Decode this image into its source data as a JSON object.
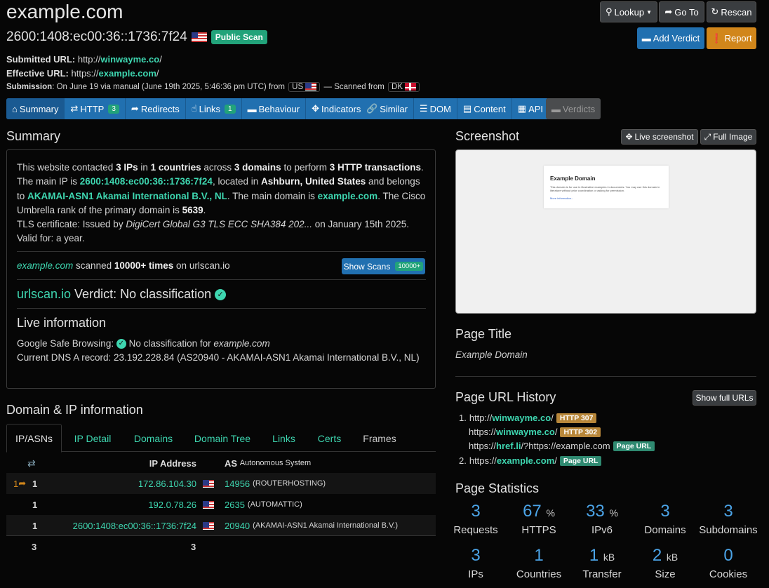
{
  "header": {
    "site": "example.com",
    "ip": "2600:1408:ec00:36::1736:7f24",
    "public_scan": "Public Scan",
    "submitted_label": "Submitted URL:",
    "submitted_prefix": "http://",
    "submitted_host": "winwayme.co",
    "submitted_suffix": "/",
    "effective_label": "Effective URL:",
    "effective_prefix": "https://",
    "effective_host": "example.com",
    "effective_suffix": "/",
    "submission_label": "Submission",
    "submission_text": ": On June 19 via manual (June 19th 2025, 5:46:36 pm UTC) from",
    "from_country": "US",
    "scanned_from_text": "— Scanned from",
    "scanned_country": "DK"
  },
  "actions": {
    "lookup": "Lookup",
    "goto": "Go To",
    "rescan": "Rescan",
    "add_verdict": "Add Verdict",
    "report": "Report"
  },
  "tabs": {
    "group1": [
      {
        "label": "Summary",
        "icon": "home-icon",
        "glyph": "⌂"
      },
      {
        "label": "HTTP",
        "icon": "exchange-icon",
        "glyph": "⇄",
        "count": "3"
      },
      {
        "label": "Redirects",
        "icon": "share-icon",
        "glyph": "➦"
      },
      {
        "label": "Links",
        "icon": "thumbs-up-icon",
        "glyph": "☝",
        "count": "1"
      },
      {
        "label": "Behaviour",
        "icon": "comment-icon",
        "glyph": "▬"
      },
      {
        "label": "Indicators",
        "icon": "crosshairs-icon",
        "glyph": "✥"
      }
    ],
    "group2": [
      {
        "label": "Similar",
        "icon": "link-icon",
        "glyph": "🔗"
      },
      {
        "label": "DOM",
        "icon": "list-icon",
        "glyph": "☰"
      },
      {
        "label": "Content",
        "icon": "file-icon",
        "glyph": "▤"
      },
      {
        "label": "API",
        "icon": "qrcode-icon",
        "glyph": "▦"
      }
    ],
    "verdicts": "Verdicts"
  },
  "summary": {
    "title": "Summary",
    "p1": {
      "t1": "This website contacted ",
      "ips": "3 IPs",
      "t2": " in ",
      "countries": "1 countries",
      "t3": " across ",
      "domains": "3 domains",
      "t4": " to perform ",
      "trans": "3 HTTP transactions",
      "t5": ".",
      "t6": "The main IP is ",
      "ip": "2600:1408:ec00:36::1736:7f24",
      "t7": ", located in ",
      "loc": "Ashburn, United States",
      "t8": " and belongs to ",
      "asn": "AKAMAI-ASN1 Akamai International B.V., NL",
      "t9": ". The main domain is ",
      "domain": "example.com",
      "t10": ". The Cisco Umbrella rank of the primary domain is ",
      "rank": "5639",
      "t11": ".",
      "tls": "TLS certificate: Issued by ",
      "issuer": "DigiCert Global G3 TLS ECC SHA384 202...",
      "tls2": " on January 15th 2025. Valid for: a year."
    },
    "scanned": {
      "domain": "example.com",
      "t1": " scanned ",
      "times": "10000+ times",
      "t2": " on urlscan.io",
      "btn": "Show Scans",
      "count": "10000+"
    },
    "verdict": {
      "brand": "urlscan.io",
      "text": " Verdict: No classification"
    },
    "live": {
      "title": "Live information",
      "gsb_label": "Google Safe Browsing:",
      "gsb_text": " No classification for ",
      "gsb_domain": "example.com",
      "dns": "Current DNS A record: 23.192.228.84 (AS20940 - AKAMAI-ASN1 Akamai International B.V., NL)"
    }
  },
  "domain_ip": {
    "title": "Domain & IP information",
    "tabs": [
      "IP/ASNs",
      "IP Detail",
      "Domains",
      "Domain Tree",
      "Links",
      "Certs",
      "Frames"
    ],
    "col_ip": "IP Address",
    "col_as": "AS",
    "col_as_sub": "Autonomous System",
    "rows": [
      {
        "redirects": "1",
        "count": "1",
        "ip": "172.86.104.30",
        "asn": "14956",
        "as_name": "(ROUTERHOSTING)"
      },
      {
        "redirects": "",
        "count": "1",
        "ip": "192.0.78.26",
        "asn": "2635",
        "as_name": "(AUTOMATTIC)"
      },
      {
        "redirects": "",
        "count": "1",
        "ip": "2600:1408:ec00:36::1736:7f24",
        "asn": "20940",
        "as_name": "(AKAMAI-ASN1 Akamai International B.V.)"
      }
    ],
    "total_count": "3",
    "total_ips": "3"
  },
  "screenshot": {
    "title": "Screenshot",
    "live_btn": "Live screenshot",
    "full_btn": "Full Image",
    "card_title": "Example Domain",
    "card_text": "This domain is for use in illustrative examples in documents. You may use this domain in literature without prior coordination or asking for permission.",
    "card_link": "More information..."
  },
  "page_title": {
    "title": "Page Title",
    "value": "Example Domain"
  },
  "url_history": {
    "title": "Page URL History",
    "show_full": "Show full URLs",
    "items": [
      {
        "num": "1.",
        "prefix": "http://",
        "host": "winwayme.co",
        "suffix": "/",
        "badge": "HTTP 307",
        "badge_type": "http"
      },
      {
        "num": "",
        "prefix": "https://",
        "host": "winwayme.co",
        "suffix": "/",
        "badge": "HTTP 302",
        "badge_type": "http"
      },
      {
        "num": "",
        "prefix": "https://",
        "host": "href.li",
        "suffix": "/?https://example.com",
        "badge": "Page URL",
        "badge_type": "page"
      },
      {
        "num": "2.",
        "prefix": "https://",
        "host": "example.com",
        "suffix": "/",
        "badge": "Page URL",
        "badge_type": "page"
      }
    ]
  },
  "stats": {
    "title": "Page Statistics",
    "items": [
      {
        "value": "3",
        "unit": "",
        "label": "Requests"
      },
      {
        "value": "67",
        "unit": "%",
        "label": "HTTPS"
      },
      {
        "value": "33",
        "unit": "%",
        "label": "IPv6"
      },
      {
        "value": "3",
        "unit": "",
        "label": "Domains"
      },
      {
        "value": "3",
        "unit": "",
        "label": "Subdomains"
      },
      {
        "value": "3",
        "unit": "",
        "label": "IPs"
      },
      {
        "value": "1",
        "unit": "",
        "label": "Countries"
      },
      {
        "value": "1",
        "unit": "kB",
        "label": "Transfer"
      },
      {
        "value": "2",
        "unit": "kB",
        "label": "Size"
      },
      {
        "value": "0",
        "unit": "",
        "label": "Cookies"
      }
    ]
  }
}
